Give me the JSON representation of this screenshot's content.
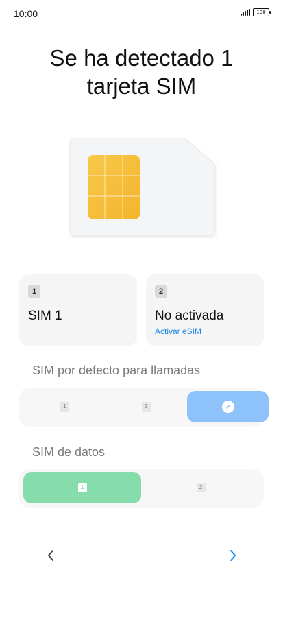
{
  "status_bar": {
    "time": "10:00",
    "battery": "100"
  },
  "page": {
    "title_line1": "Se ha detectado 1",
    "title_line2": "tarjeta SIM"
  },
  "sim_cards": [
    {
      "slot": "1",
      "title": "SIM 1",
      "link": ""
    },
    {
      "slot": "2",
      "title": "No activada",
      "link": "Activar eSIM"
    }
  ],
  "calls": {
    "label": "SIM por defecto para llamadas",
    "options": [
      "1",
      "2"
    ],
    "selected": "edit-option"
  },
  "data": {
    "label": "SIM de datos",
    "options": [
      "1",
      "2"
    ],
    "selected": "1"
  },
  "icons": {
    "status": [
      "signal-icon",
      "battery-icon"
    ],
    "illustration": "sim-card-illustration-icon",
    "edit": "pencil-icon",
    "back": "chevron-left-icon",
    "next": "chevron-right-icon"
  },
  "colors": {
    "accent_blue": "#8ec2fb",
    "accent_green": "#86dcab",
    "link_blue": "#1e88e5",
    "next_arrow": "#1a8cf0"
  }
}
